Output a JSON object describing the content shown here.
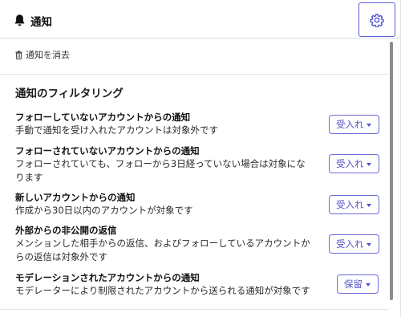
{
  "header": {
    "title": "通知",
    "bell_icon": "bell-icon",
    "settings_icon": "gear-icon"
  },
  "clear": {
    "label": "通知を消去",
    "icon": "trash-icon"
  },
  "filtering": {
    "title": "通知のフィルタリング",
    "rows": [
      {
        "title": "フォローしていないアカウントからの通知",
        "desc": "手動で通知を受け入れたアカウントは対象外です",
        "policy": "受入れ"
      },
      {
        "title": "フォローされていないアカウントからの通知",
        "desc": "フォローされていても、フォローから3日経っていない場合は対象にな\nります",
        "policy": "受入れ"
      },
      {
        "title": "新しいアカウントからの通知",
        "desc": "作成から30日以内のアカウントが対象です",
        "policy": "受入れ"
      },
      {
        "title": "外部からの非公開の返信",
        "desc": "メンションした相手からの返信、およびフォローしているアカウントか\nらの返信は対象外です",
        "policy": "受入れ"
      },
      {
        "title": "モデレーションされたアカウントからの通知",
        "desc": "モデレーターにより制限されたアカウントから送られる通知が対象です",
        "policy": "保留"
      }
    ]
  },
  "colors": {
    "accent": "#5b5bd6",
    "scrollbar": "#8c8c92"
  }
}
